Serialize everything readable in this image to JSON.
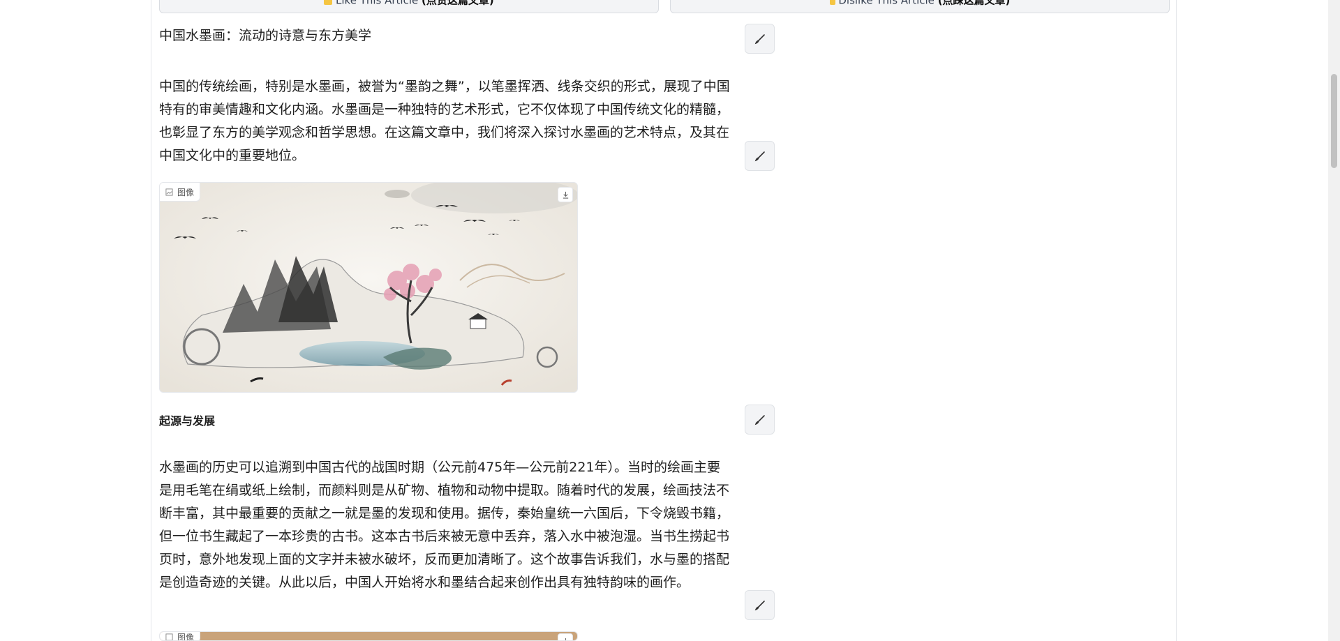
{
  "vote": {
    "like_label": "Like This Article",
    "like_cn": "(点赞这篇文章)",
    "dislike_label": "Dislike This Article",
    "dislike_cn": "(点踩这篇文章)",
    "like_icon": "thumbs-up-icon",
    "dislike_icon": "thumbs-down-icon"
  },
  "article": {
    "title": "中国水墨画：流动的诗意与东方美学",
    "intro": "中国的传统绘画，特别是水墨画，被誉为“墨韵之舞”，以笔墨挥洒、线条交织的形式，展现了中国特有的审美情趣和文化内涵。水墨画是一种独特的艺术形式，它不仅体现了中国传统文化的精髓，也彰显了东方的美学观念和哲学思想。在这篇文章中，我们将深入探讨水墨画的艺术特点，及其在中国文化中的重要地位。",
    "section1_heading": "起源与发展",
    "section1_body": "水墨画的历史可以追溯到中国古代的战国时期（公元前475年—公元前221年）。当时的绘画主要是用毛笔在绢或纸上绘制，而颜料则是从矿物、植物和动物中提取。随着时代的发展，绘画技法不断丰富，其中最重要的贡献之一就是墨的发现和使用。据传，秦始皇统一六国后，下令烧毁书籍，但一位书生藏起了一本珍贵的古书。这本古书后来被无意中丢弃，落入水中被泡湿。当书生捞起书页时，意外地发现上面的文字并未被水破坏，反而更加清晰了。这个故事告诉我们，水与墨的搭配是创造奇迹的关键。从此以后，中国人开始将水和墨结合起来创作出具有独特韵味的画作。"
  },
  "image_label": "图像",
  "icons": {
    "edit": "brush-icon",
    "image": "image-icon",
    "download": "download-icon"
  }
}
